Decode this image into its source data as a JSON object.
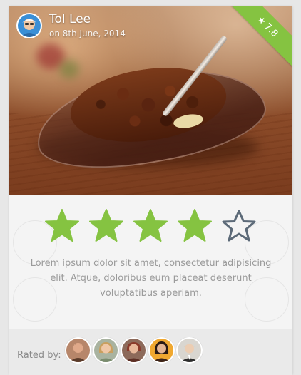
{
  "header": {
    "user_name": "Tol Lee",
    "date": "on 8th June, 2014",
    "rating_badge": "7.8"
  },
  "rating": {
    "value": 4,
    "max": 5
  },
  "description": "Lorem ipsum dolor sit amet, consectetur adipisicing elit. Atque, doloribus eum placeat deserunt voluptatibus aperiam.",
  "footer": {
    "rated_by_label": "Rated by:",
    "raters": [
      "rater-1",
      "rater-2",
      "rater-3",
      "rater-4",
      "rater-5"
    ]
  },
  "colors": {
    "accent_green": "#85c341",
    "star_empty": "#5c6a78"
  }
}
